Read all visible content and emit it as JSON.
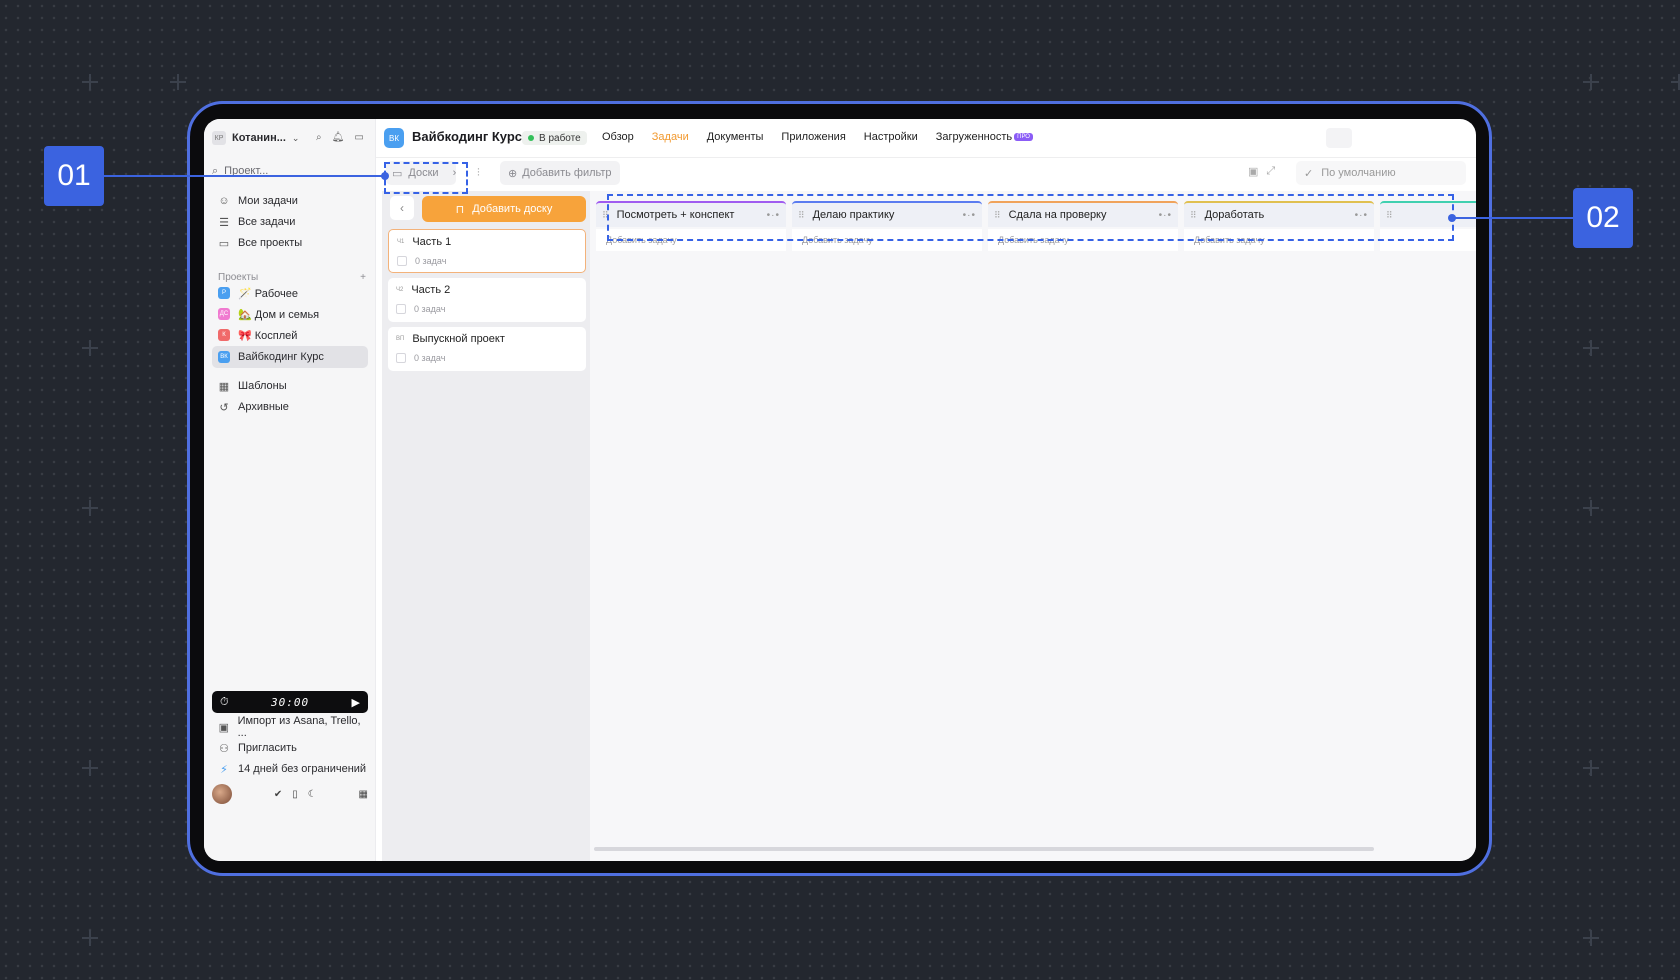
{
  "annotations": {
    "marker1": "01",
    "marker2": "02"
  },
  "sidebar": {
    "workspace_avatar": "КР",
    "workspace_name": "Котанин...",
    "search_placeholder": "Проект...",
    "nav": [
      {
        "label": "Мои задачи"
      },
      {
        "label": "Все задачи"
      },
      {
        "label": "Все проекты"
      }
    ],
    "projects_header": "Проекты",
    "projects": [
      {
        "abbr": "Р",
        "label": "🪄 Рабочее",
        "color": "#4a9ff0"
      },
      {
        "abbr": "ДС",
        "label": "🏡 Дом и семья",
        "color": "#f07ad0"
      },
      {
        "abbr": "К",
        "label": "🎀 Косплей",
        "color": "#f06a6a"
      },
      {
        "abbr": "ВК",
        "label": "Вайбкодинг Курс",
        "color": "#4a9ff0"
      }
    ],
    "extra": [
      {
        "label": "Шаблоны"
      },
      {
        "label": "Архивные"
      }
    ],
    "timer": "30:00",
    "bottom_links": [
      {
        "label": "Импорт из Asana, Trello, ..."
      },
      {
        "label": "Пригласить"
      },
      {
        "label": "14 дней без ограничений"
      }
    ]
  },
  "header": {
    "project_abbr": "ВК",
    "project_title": "Вайбкодинг Курс",
    "status": "В работе",
    "tabs": [
      {
        "label": "Обзор"
      },
      {
        "label": "Задачи"
      },
      {
        "label": "Документы"
      },
      {
        "label": "Приложения"
      },
      {
        "label": "Настройки"
      },
      {
        "label": "Загруженность"
      }
    ],
    "pro_badge": "ПРО"
  },
  "toolbar": {
    "boards_label": "Доски",
    "filter_label": "Добавить фильтр",
    "default_label": "По умолчанию"
  },
  "boards": {
    "add_label": "Добавить доску",
    "items": [
      {
        "abbr": "Ч1",
        "title": "Часть 1",
        "count": "0 задач"
      },
      {
        "abbr": "Ч2",
        "title": "Часть 2",
        "count": "0 задач"
      },
      {
        "abbr": "ВП",
        "title": "Выпускной проект",
        "count": "0 задач"
      }
    ]
  },
  "columns": {
    "add_task_label": "Добавить задачу",
    "items": [
      {
        "title": "Посмотреть + конспект",
        "color": "#a05cf0"
      },
      {
        "title": "Делаю практику",
        "color": "#5b7cf0"
      },
      {
        "title": "Сдала на проверку",
        "color": "#f0a35b"
      },
      {
        "title": "Доработать",
        "color": "#e0c050"
      }
    ]
  }
}
